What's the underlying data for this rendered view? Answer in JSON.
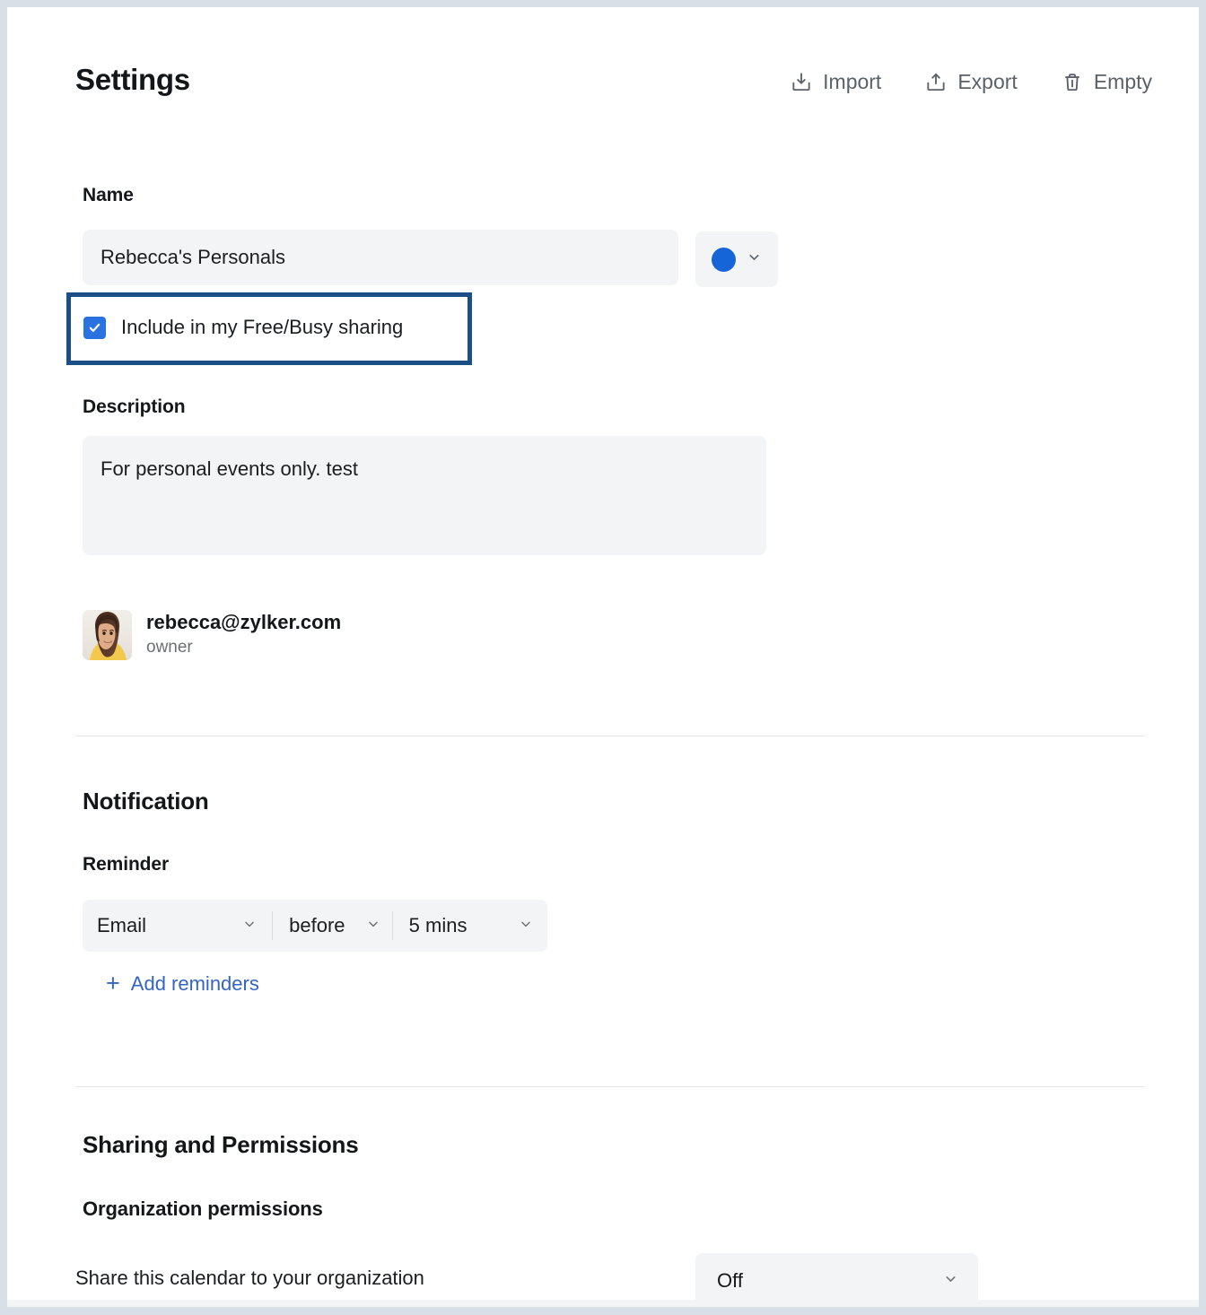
{
  "header": {
    "title": "Settings",
    "actions": [
      {
        "label": "Import",
        "icon": "import-icon"
      },
      {
        "label": "Export",
        "icon": "export-icon"
      },
      {
        "label": "Empty",
        "icon": "trash-icon"
      }
    ]
  },
  "name_section": {
    "label": "Name",
    "value": "Rebecca's Personals",
    "placeholder": "Name",
    "color_swatch": "#1565d8",
    "color_dropdown_icon": "chevron-down-icon"
  },
  "freebusy": {
    "label": "Include in my Free/Busy sharing",
    "checked": true,
    "highlight_color": "#1c4f86",
    "checkbox_color": "#2a72e0"
  },
  "description_section": {
    "label": "Description",
    "value": "For personal events only. test",
    "placeholder": "Description"
  },
  "owner": {
    "email": "rebecca@zylker.com",
    "role": "owner"
  },
  "notification": {
    "section_title": "Notification",
    "reminder_label": "Reminder",
    "reminder": {
      "method": "Email",
      "timing": "before",
      "offset": "5 mins"
    },
    "add_reminders_label": "Add reminders",
    "add_icon": "plus-icon",
    "link_color": "#3465c4"
  },
  "sharing": {
    "section_title": "Sharing and Permissions",
    "org_permissions_label": "Organization permissions",
    "share_row_label": "Share this calendar to your organization",
    "share_value": "Off"
  }
}
